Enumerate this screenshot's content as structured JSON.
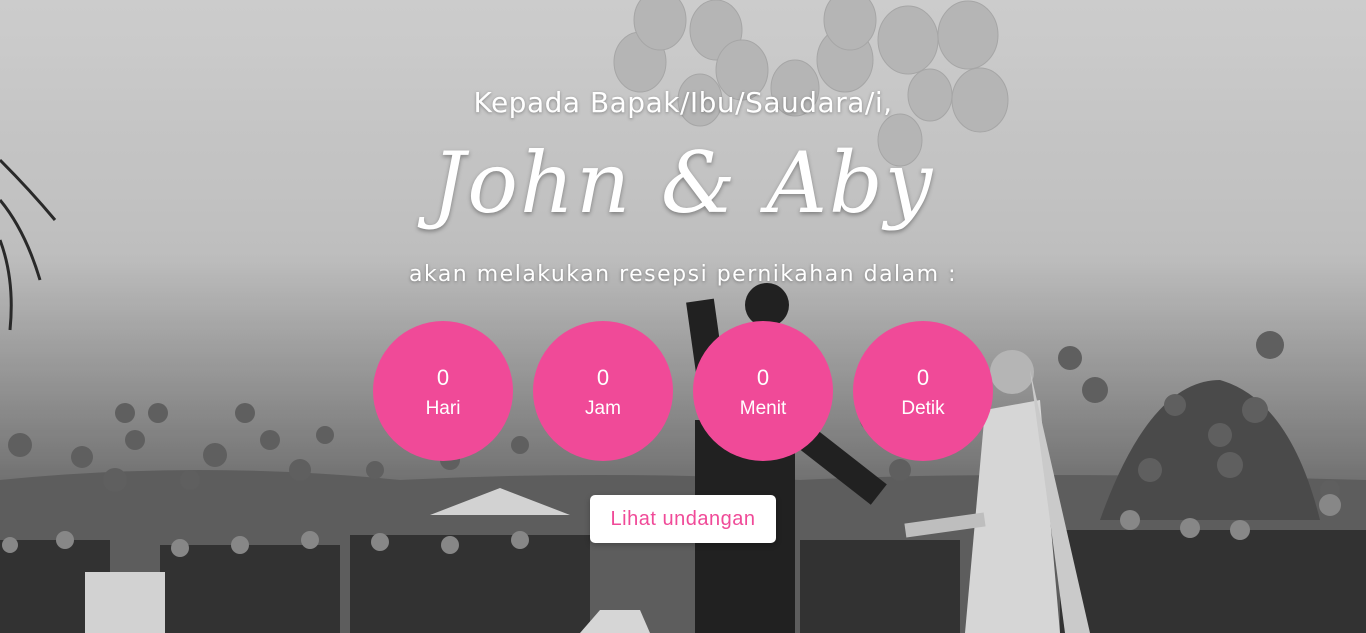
{
  "hero": {
    "greeting": "Kepada Bapak/Ibu/Saudara/i,",
    "couple_names": "John & Aby",
    "subtitle": "akan melakukan resepsi pernikahan dalam :"
  },
  "countdown": {
    "accent_color": "#f04a98",
    "items": [
      {
        "value": "0",
        "unit": "Hari"
      },
      {
        "value": "0",
        "unit": "Jam"
      },
      {
        "value": "0",
        "unit": "Menit"
      },
      {
        "value": "0",
        "unit": "Detik"
      }
    ]
  },
  "cta": {
    "label": "Lihat undangan",
    "text_color": "#f04a98"
  },
  "background": {
    "description_icon": "wedding-photo-background"
  }
}
